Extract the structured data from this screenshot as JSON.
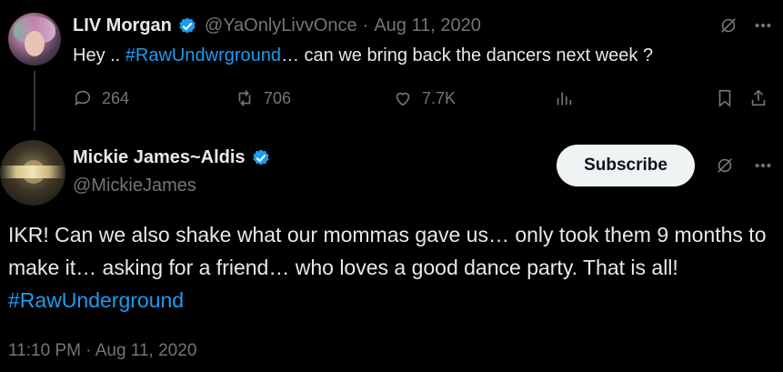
{
  "parent_tweet": {
    "name": "LIV Morgan",
    "handle": "@YaOnlyLivvOnce",
    "separator": "·",
    "date": "Aug 11, 2020",
    "text_prefix": "Hey .. ",
    "hashtag": "#RawUndwrground",
    "text_suffix": "… can we bring back the dancers next week ?",
    "replies": "264",
    "retweets": "706",
    "likes": "7.7K"
  },
  "main_tweet": {
    "name": "Mickie James~Aldis",
    "handle": "@MickieJames",
    "subscribe_label": "Subscribe",
    "text": "IKR! Can we also shake what our mommas gave us… only took them 9 months to make it… asking for a friend… who loves a good dance party. That is all! ",
    "hashtag": "#RawUnderground",
    "timestamp": "11:10 PM · Aug 11, 2020"
  },
  "colors": {
    "background": "#000000",
    "text": "#e7e9ea",
    "muted": "#71767b",
    "link": "#1d9bf0",
    "verified": "#1d9bf0",
    "subscribe_bg": "#eff3f4"
  }
}
